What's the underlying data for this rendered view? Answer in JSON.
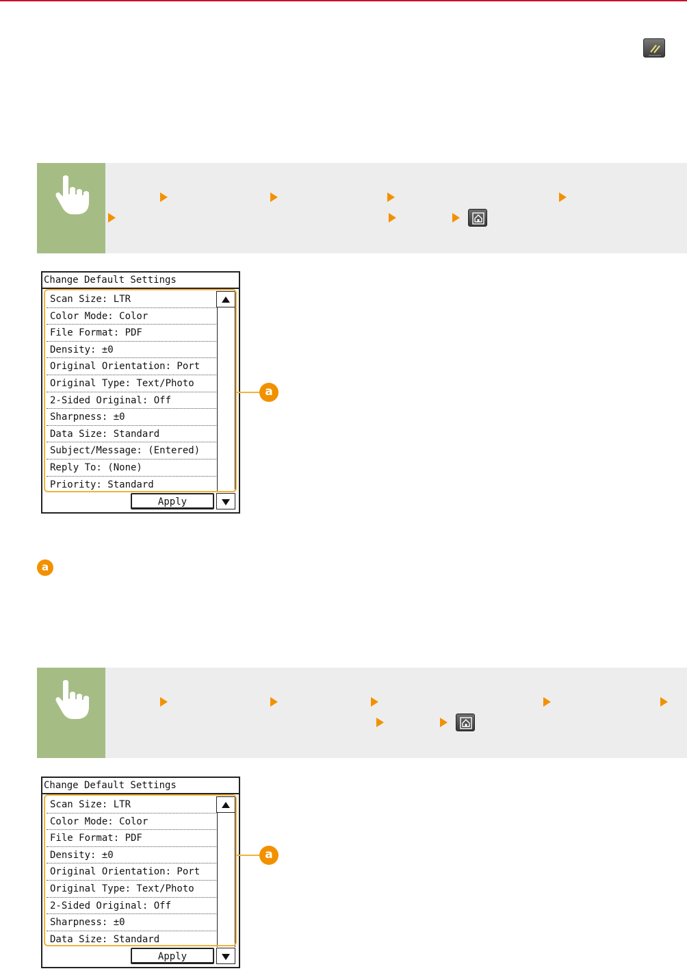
{
  "icons": {
    "reset_key": "reset-key-icon",
    "hand": "touch-hand-icon",
    "path_arrow": "orange-path-arrow-icon",
    "home_key": "home-key-icon",
    "scroll_up": "triangle-up-icon",
    "scroll_down": "triangle-down-icon"
  },
  "colors": {
    "top_rule": "#c8102e",
    "step_bar": "#ededed",
    "hand_box": "#a5bd85",
    "arrow": "#f29100",
    "callout": "#f0b23a"
  },
  "screens": [
    {
      "title": "Change Default Settings",
      "items": [
        "Scan Size: LTR",
        "Color Mode: Color",
        "File Format: PDF",
        "Density: ±0",
        "Original Orientation: Port",
        "Original Type: Text/Photo",
        "2-Sided Original: Off",
        "Sharpness: ±0",
        "Data Size: Standard",
        "Subject/Message: (Entered)",
        "Reply To: (None)",
        "Priority: Standard"
      ],
      "apply_label": "Apply",
      "callout": "a"
    },
    {
      "title": "Change Default Settings",
      "items": [
        "Scan Size: LTR",
        "Color Mode: Color",
        "File Format: PDF",
        "Density: ±0",
        "Original Orientation: Port",
        "Original Type: Text/Photo",
        "2-Sided Original: Off",
        "Sharpness: ±0",
        "Data Size: Standard"
      ],
      "apply_label": "Apply",
      "callout": "a"
    }
  ],
  "legend": {
    "badge": "a"
  }
}
